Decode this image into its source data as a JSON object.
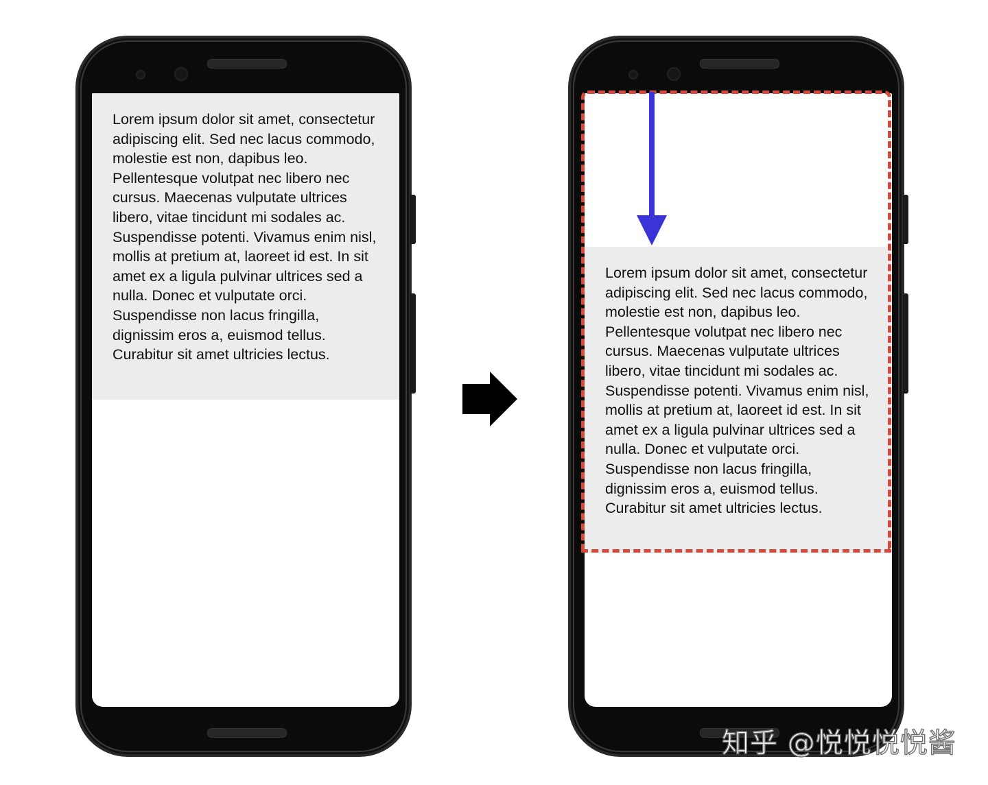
{
  "paragraph_text": "Lorem ipsum dolor sit amet, consectetur adipiscing elit. Sed nec lacus commodo, molestie est non, dapibus leo. Pellentesque volutpat nec libero nec cursus. Maecenas vulputate ultrices libero, vitae tincidunt mi sodales ac. Suspendisse potenti. Vivamus enim nisl, mollis at pretium at, laoreet id est. In sit amet ex a ligula pulvinar ultrices sed a nulla. Donec et vulputate orci. Suspendisse non lacus fringilla, dignissim eros a, euismod tellus. Curabitur sit amet ultricies lectus.",
  "left_phone": {
    "text": "Lorem ipsum dolor sit amet, consectetur adipiscing elit. Sed nec lacus commodo, molestie est non, dapibus leo. Pellentesque volutpat nec libero nec cursus. Maecenas vulputate ultrices libero, vitae tincidunt mi sodales ac. Suspendisse potenti. Vivamus enim nisl, mollis at pretium at, laoreet id est. In sit amet ex a ligula pulvinar ultrices sed a nulla. Donec et vulputate orci. Suspendisse non lacus fringilla, dignissim eros a, euismod tellus. Curabitur sit amet ultricies lectus."
  },
  "right_phone": {
    "text": "Lorem ipsum dolor sit amet, consectetur adipiscing elit. Sed nec lacus commodo, molestie est non, dapibus leo. Pellentesque volutpat nec libero nec cursus. Maecenas vulputate ultrices libero, vitae tincidunt mi sodales ac. Suspendisse potenti. Vivamus enim nisl, mollis at pretium at, laoreet id est. In sit amet ex a ligula pulvinar ultrices sed a nulla. Donec et vulputate orci. Suspendisse non lacus fringilla, dignissim eros a, euismod tellus. Curabitur sit amet ultricies lectus."
  },
  "icons": {
    "transition": "right-arrow-icon",
    "shift": "down-arrow-icon"
  },
  "colors": {
    "text_block_background": "#ececec",
    "dashed_outline": "#d44a3c",
    "shift_arrow": "#3a34d6",
    "transition_arrow": "#000000",
    "phone_body": "#0b0b0b"
  },
  "watermark": "知乎 @悦悦悦悦酱"
}
